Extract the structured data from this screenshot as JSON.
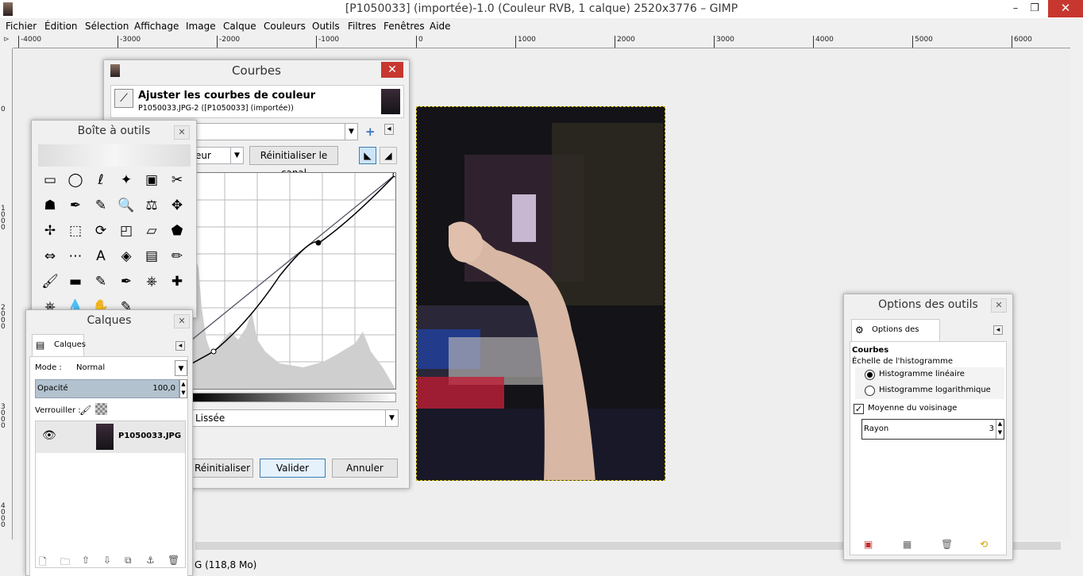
{
  "window": {
    "title": "[P1050033] (importée)-1.0 (Couleur RVB, 1 calque) 2520x3776 – GIMP",
    "minimize": "–",
    "maximize": "❐",
    "close": "✕"
  },
  "menu": [
    "Fichier",
    "Édition",
    "Sélection",
    "Affichage",
    "Image",
    "Calque",
    "Couleurs",
    "Outils",
    "Filtres",
    "Fenêtres",
    "Aide"
  ],
  "ruler": {
    "h_ticks": [
      "-4000",
      "-3000",
      "-2000",
      "-1000",
      "0",
      "1000",
      "2000",
      "3000",
      "4000",
      "5000",
      "6000"
    ],
    "v_ticks": [
      "0",
      "1\n0\n0\n0",
      "2\n0\n0\n0",
      "3\n0\n0\n0",
      "4\n0\n0\n0"
    ]
  },
  "status": {
    "text": "G (118,8 Mo)"
  },
  "curves": {
    "title": "Courbes",
    "close": "✕",
    "header_title": "Ajuster les courbes de couleur",
    "header_sub": "P1050033.JPG-2 ([P1050033] (importée))",
    "preset_add": "+",
    "preset_menu": "◂",
    "channel_value": "eur",
    "reset_channel": "Réinitialiser le canal",
    "curve_type": "Lissée",
    "reset": "Réinitialiser",
    "ok": "Valider",
    "cancel": "Annuler"
  },
  "toolbox": {
    "title": "Boîte à outils",
    "close": "✕",
    "tools": [
      "rect-select-icon",
      "ellipse-select-icon",
      "free-select-icon",
      "fuzzy-select-icon",
      "color-select-icon",
      "scissors-icon",
      "foreground-select-icon",
      "paths-icon",
      "color-picker-icon",
      "zoom-icon",
      "measure-icon",
      "move-icon",
      "align-icon",
      "crop-icon",
      "rotate-icon",
      "scale-icon",
      "shear-icon",
      "perspective-icon",
      "flip-icon",
      "cage-icon",
      "text-icon",
      "bucket-fill-icon",
      "blend-icon",
      "pencil-icon",
      "paintbrush-icon",
      "eraser-icon",
      "airbrush-icon",
      "ink-icon",
      "clone-icon",
      "heal-icon",
      "perspective-clone-icon",
      "blur-icon",
      "smudge-icon",
      "dodge-burn-icon"
    ],
    "tool_glyphs": [
      "▭",
      "◯",
      "ℓ",
      "✦",
      "▣",
      "✂",
      "☗",
      "✒",
      "✎",
      "🔍",
      "⚖",
      "✥",
      "✢",
      "⬚",
      "⟳",
      "◰",
      "▱",
      "⬟",
      "⇔",
      "⋯",
      "A",
      "◈",
      "▤",
      "✏",
      "🖌",
      "▬",
      "✎",
      "✒",
      "⎈",
      "✚",
      "⎈",
      "💧",
      "✋",
      "✎"
    ]
  },
  "layers": {
    "title": "Calques",
    "close": "✕",
    "tab_label": "Calques",
    "tab_menu": "◂",
    "mode_label": "Mode :",
    "mode_value": "Normal",
    "opacity_label": "Opacité",
    "opacity_value": "100,0",
    "lock_label": "Verrouiller :",
    "layer_name": "P1050033.JPG",
    "bottom_icons": [
      "new-layer-icon",
      "new-group-icon",
      "raise-layer-icon",
      "lower-layer-icon",
      "duplicate-layer-icon",
      "anchor-layer-icon",
      "delete-layer-icon"
    ],
    "bottom_glyphs": [
      "🗋",
      "🗀",
      "⇧",
      "⇩",
      "⧉",
      "⚓",
      "🗑"
    ]
  },
  "tool_options": {
    "title": "Options des outils",
    "close": "✕",
    "tab_label": "Options des outils",
    "tab_menu": "◂",
    "section": "Courbes",
    "histogram_scale": "Échelle de l'histogramme",
    "linear": "Histogramme linéaire",
    "logarithmic": "Histogramme logarithmique",
    "sample_average": "Moyenne du voisinage",
    "radius_label": "Rayon",
    "radius_value": "3",
    "linear_checked": true,
    "sample_average_checked": true
  }
}
